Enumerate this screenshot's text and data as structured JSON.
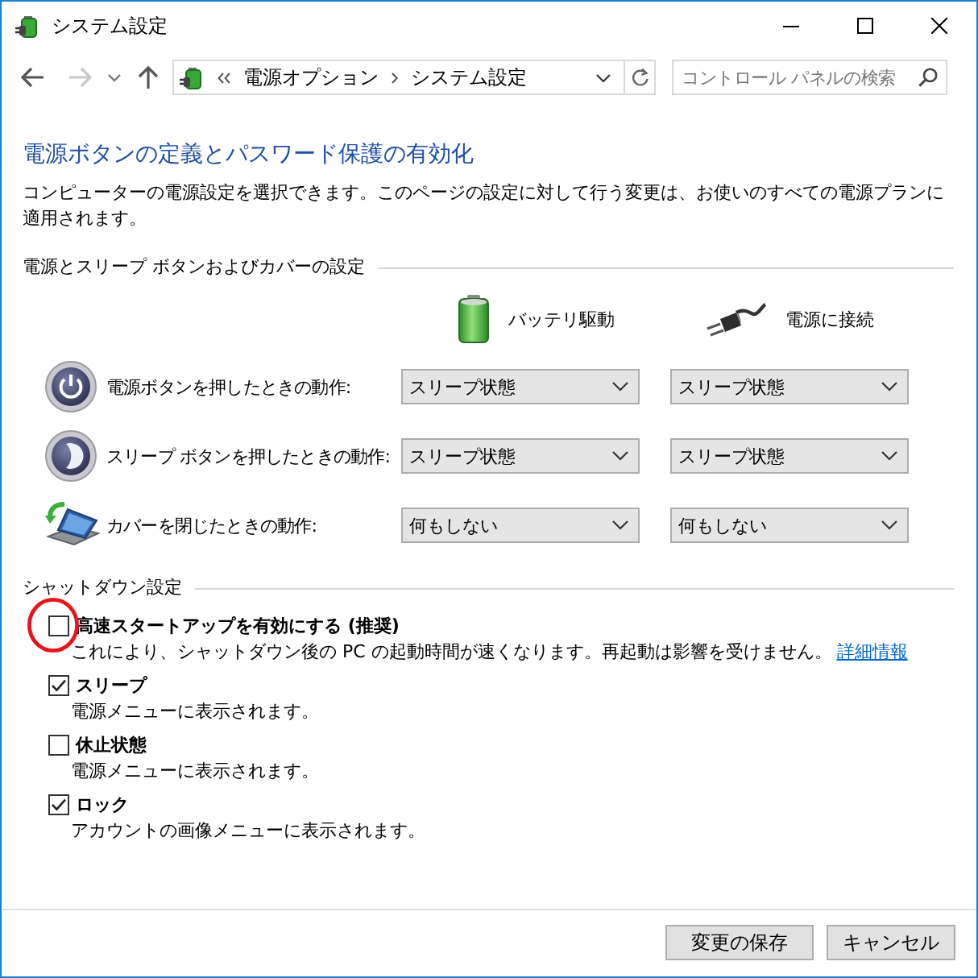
{
  "window": {
    "title": "システム設定"
  },
  "navigation": {
    "back_enabled": true,
    "forward_enabled": false
  },
  "address_bar": {
    "crumbs": [
      "電源オプション",
      "システム設定"
    ]
  },
  "search": {
    "placeholder": "コントロール パネルの検索"
  },
  "heading": "電源ボタンの定義とパスワード保護の有効化",
  "description": "コンピューターの電源設定を選択できます。このページの設定に対して行う変更は、お使いのすべての電源プランに適用されます。",
  "power_settings": {
    "title": "電源とスリープ ボタンおよびカバーの設定",
    "columns": [
      {
        "kind": "battery",
        "label": "バッテリ駆動"
      },
      {
        "kind": "plugged_in",
        "label": "電源に接続"
      }
    ],
    "rows": [
      {
        "kind": "power_button",
        "label": "電源ボタンを押したときの動作:",
        "values": [
          "スリープ状態",
          "スリープ状態"
        ]
      },
      {
        "kind": "sleep_button",
        "label": "スリープ ボタンを押したときの動作:",
        "values": [
          "スリープ状態",
          "スリープ状態"
        ]
      },
      {
        "kind": "lid",
        "label": "カバーを閉じたときの動作:",
        "values": [
          "何もしない",
          "何もしない"
        ]
      }
    ]
  },
  "shutdown_settings": {
    "title": "シャットダウン設定",
    "options": [
      {
        "label": "高速スタートアップを有効にする (推奨)",
        "description": "これにより、シャットダウン後の PC の起動時間が速くなります。再起動は影響を受けません。",
        "link": "詳細情報",
        "checked": false,
        "highlighted": true
      },
      {
        "label": "スリープ",
        "description": "電源メニューに表示されます。",
        "checked": true,
        "highlighted": false
      },
      {
        "label": "休止状態",
        "description": "電源メニューに表示されます。",
        "checked": false,
        "highlighted": false
      },
      {
        "label": "ロック",
        "description": "アカウントの画像メニューに表示されます。",
        "checked": true,
        "highlighted": false
      }
    ]
  },
  "buttons": [
    "変更の保存",
    "キャンセル"
  ]
}
